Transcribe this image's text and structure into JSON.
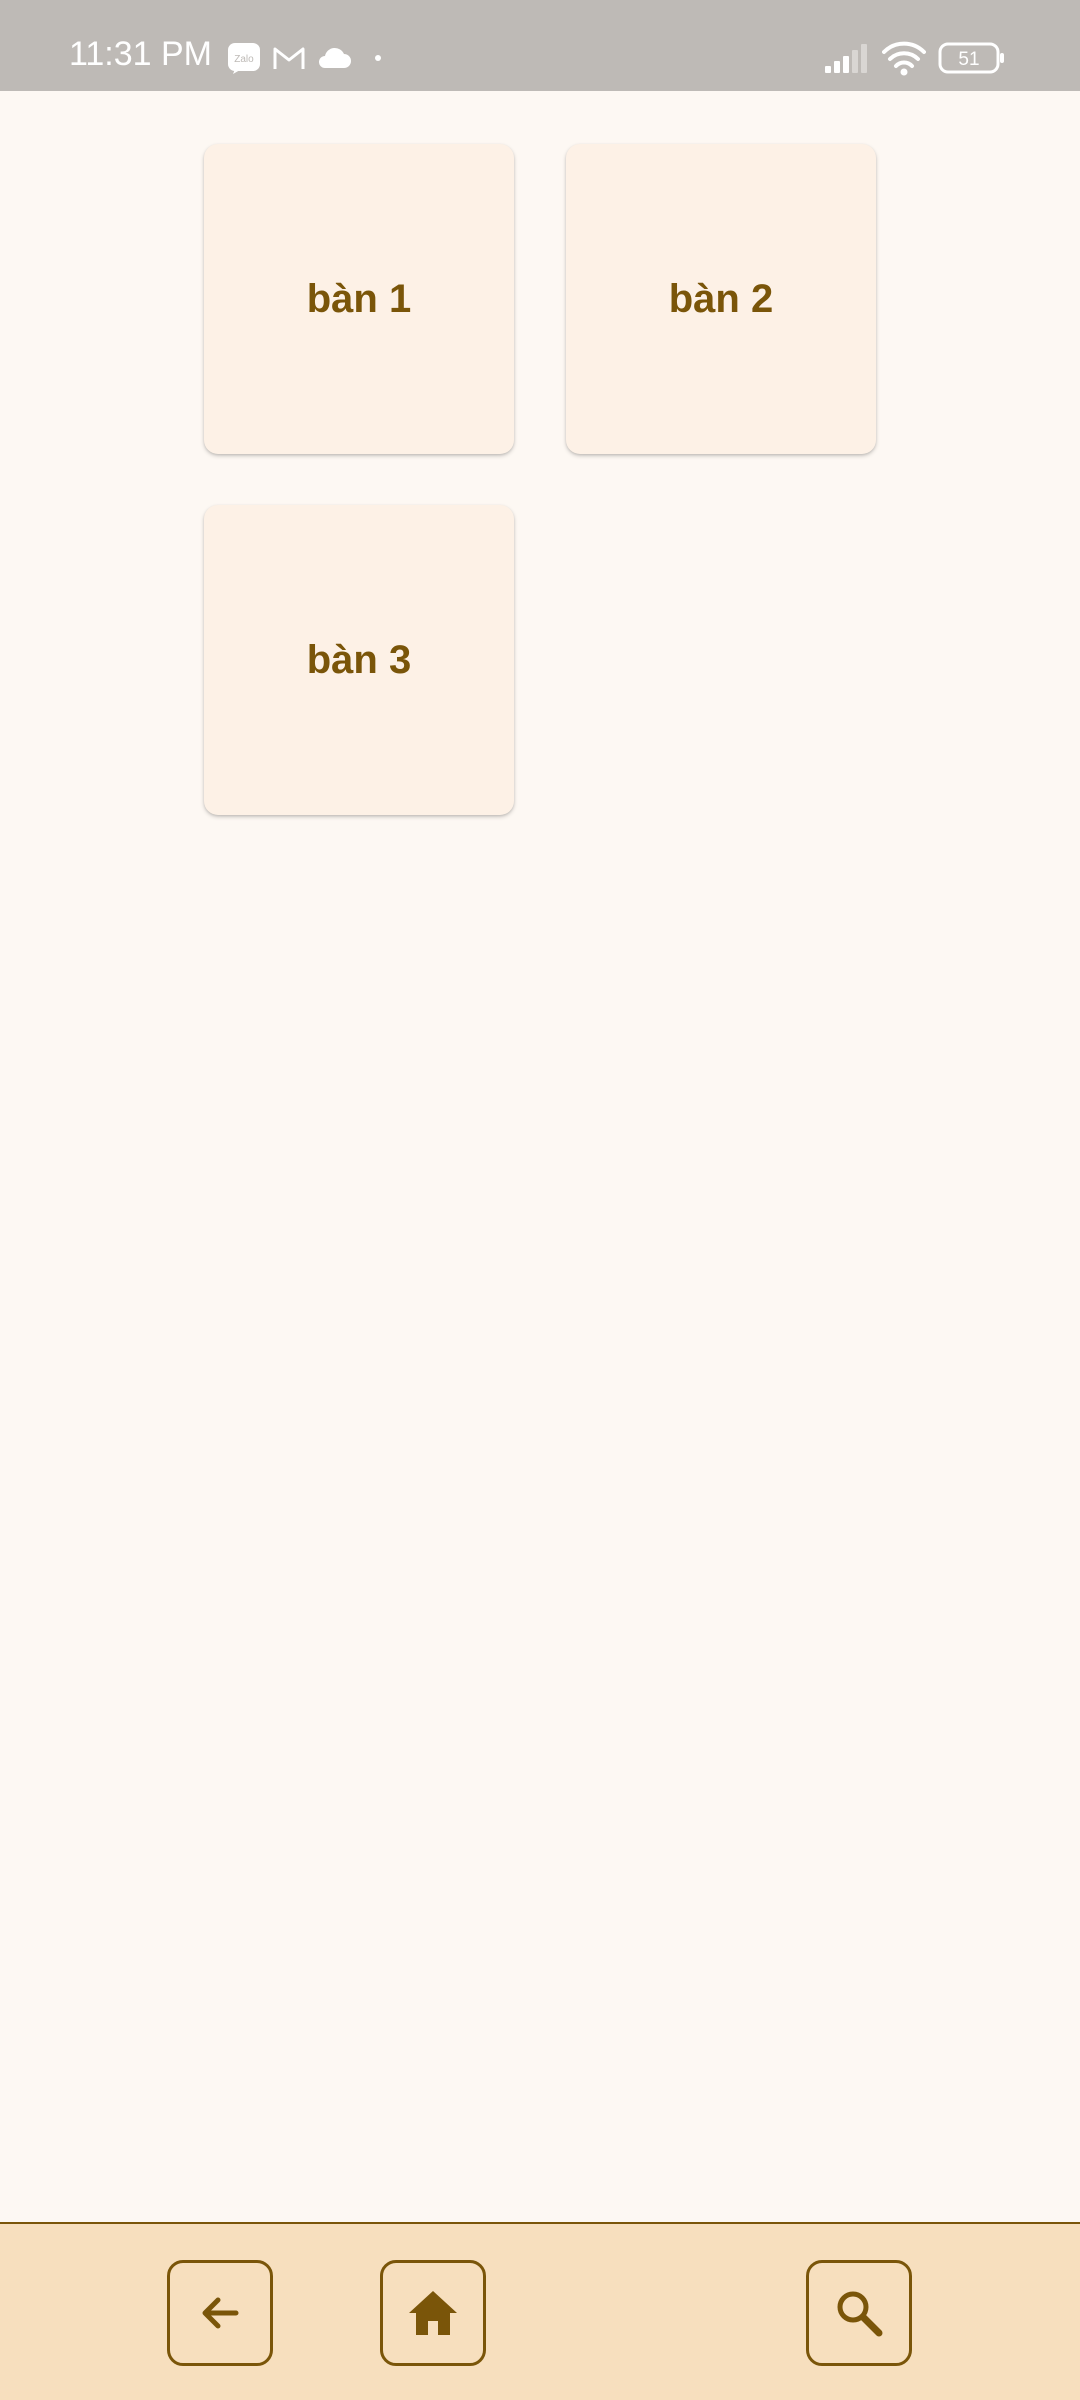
{
  "status_bar": {
    "time": "11:31 PM",
    "notification_icons": [
      "zalo-icon",
      "gmail-icon",
      "cloud-icon",
      "dot-icon"
    ],
    "signal_icon": "signal-icon",
    "wifi_icon": "wifi-icon",
    "battery_level": "51"
  },
  "tables": [
    {
      "label": "bàn 1"
    },
    {
      "label": "bàn 2"
    },
    {
      "label": "bàn 3"
    }
  ],
  "bottom_nav": {
    "back_icon": "arrow-left-icon",
    "home_icon": "home-icon",
    "search_icon": "search-icon"
  },
  "colors": {
    "accent": "#7A5509",
    "card_bg": "#FDF1E6",
    "page_bg": "#FDF8F3",
    "bottom_bar_bg": "#F7DFBE",
    "status_bar_bg": "#BEBAB6"
  }
}
